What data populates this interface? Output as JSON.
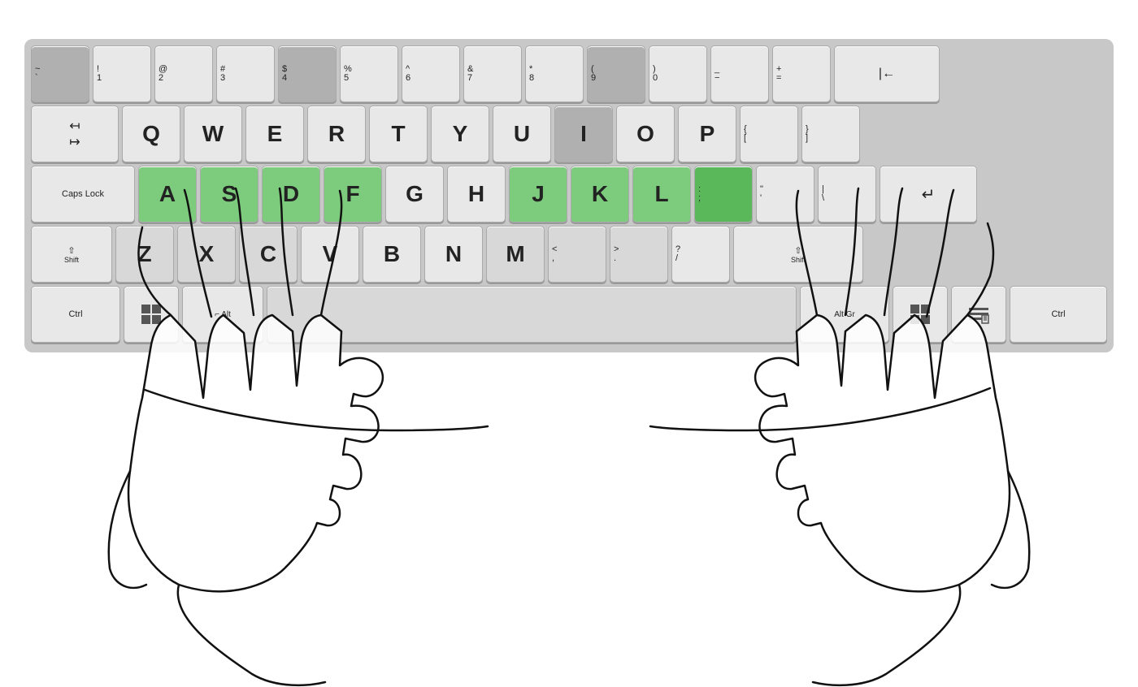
{
  "keyboard": {
    "rows": [
      {
        "id": "row-number",
        "keys": [
          {
            "id": "tilde",
            "top": "~",
            "bottom": "`",
            "label": "",
            "style": "dark",
            "w": "w1"
          },
          {
            "id": "1",
            "top": "!",
            "bottom": "1",
            "label": "",
            "style": "normal",
            "w": "w1"
          },
          {
            "id": "2",
            "top": "@",
            "bottom": "2",
            "label": "",
            "style": "normal",
            "w": "w1"
          },
          {
            "id": "3",
            "top": "#",
            "bottom": "3",
            "label": "",
            "style": "normal",
            "w": "w1"
          },
          {
            "id": "4",
            "top": "$",
            "bottom": "4",
            "label": "",
            "style": "dark",
            "w": "w1"
          },
          {
            "id": "5",
            "top": "%",
            "bottom": "5",
            "label": "",
            "style": "normal",
            "w": "w1"
          },
          {
            "id": "6",
            "top": "^",
            "bottom": "6",
            "label": "",
            "style": "normal",
            "w": "w1"
          },
          {
            "id": "7",
            "top": "&",
            "bottom": "7",
            "label": "",
            "style": "normal",
            "w": "w1"
          },
          {
            "id": "8",
            "top": "*",
            "bottom": "8",
            "label": "",
            "style": "normal",
            "w": "w1"
          },
          {
            "id": "9",
            "top": "(",
            "bottom": "9",
            "label": "",
            "style": "dark",
            "w": "w1"
          },
          {
            "id": "0",
            "top": ")",
            "bottom": "0",
            "label": "",
            "style": "normal",
            "w": "w1"
          },
          {
            "id": "minus",
            "top": "_",
            "bottom": "-",
            "label": "",
            "style": "normal",
            "w": "w1"
          },
          {
            "id": "equal",
            "top": "+",
            "bottom": "=",
            "label": "",
            "style": "normal",
            "w": "w1"
          },
          {
            "id": "backspace",
            "top": "",
            "bottom": "",
            "label": "←—",
            "style": "normal",
            "w": "w-backspace"
          }
        ]
      },
      {
        "id": "row-qwerty",
        "keys": [
          {
            "id": "tab",
            "top": "",
            "bottom": "",
            "label": "↤\n↦",
            "style": "normal",
            "w": "w-tab"
          },
          {
            "id": "q",
            "top": "",
            "bottom": "",
            "main": "Q",
            "style": "normal",
            "w": "w1"
          },
          {
            "id": "w",
            "top": "",
            "bottom": "",
            "main": "W",
            "style": "normal",
            "w": "w1"
          },
          {
            "id": "e",
            "top": "",
            "bottom": "",
            "main": "E",
            "style": "normal",
            "w": "w1"
          },
          {
            "id": "r",
            "top": "",
            "bottom": "",
            "main": "R",
            "style": "normal",
            "w": "w1"
          },
          {
            "id": "t",
            "top": "",
            "bottom": "",
            "main": "T",
            "style": "normal",
            "w": "w1"
          },
          {
            "id": "y",
            "top": "",
            "bottom": "",
            "main": "Y",
            "style": "normal",
            "w": "w1"
          },
          {
            "id": "u",
            "top": "",
            "bottom": "",
            "main": "U",
            "style": "normal",
            "w": "w1"
          },
          {
            "id": "i",
            "top": "",
            "bottom": "",
            "main": "I",
            "style": "dark",
            "w": "w1"
          },
          {
            "id": "o",
            "top": "",
            "bottom": "",
            "main": "O",
            "style": "normal",
            "w": "w1"
          },
          {
            "id": "p",
            "top": "",
            "bottom": "",
            "main": "P",
            "style": "normal",
            "w": "w1"
          },
          {
            "id": "lbracket",
            "top": "{",
            "bottom": "[",
            "label": "",
            "style": "normal",
            "w": "w1"
          },
          {
            "id": "rbracket",
            "top": "}",
            "bottom": "]",
            "label": "",
            "style": "normal",
            "w": "w1"
          }
        ]
      },
      {
        "id": "row-asdf",
        "keys": [
          {
            "id": "capslock",
            "top": "",
            "bottom": "",
            "label": "Caps Lock",
            "style": "normal",
            "w": "w-caps"
          },
          {
            "id": "a",
            "top": "",
            "bottom": "",
            "main": "A",
            "style": "green",
            "w": "w1"
          },
          {
            "id": "s",
            "top": "",
            "bottom": "",
            "main": "S",
            "style": "green",
            "w": "w1"
          },
          {
            "id": "d",
            "top": "",
            "bottom": "",
            "main": "D",
            "style": "green",
            "w": "w1"
          },
          {
            "id": "f",
            "top": "",
            "bottom": "",
            "main": "F",
            "style": "green",
            "w": "w1"
          },
          {
            "id": "g",
            "top": "",
            "bottom": "",
            "main": "G",
            "style": "normal",
            "w": "w1"
          },
          {
            "id": "h",
            "top": "",
            "bottom": "",
            "main": "H",
            "style": "normal",
            "w": "w1"
          },
          {
            "id": "j",
            "top": "",
            "bottom": "",
            "main": "J",
            "style": "green",
            "w": "w1"
          },
          {
            "id": "k",
            "top": "",
            "bottom": "",
            "main": "K",
            "style": "green",
            "w": "w1"
          },
          {
            "id": "l",
            "top": "",
            "bottom": "",
            "main": "L",
            "style": "green",
            "w": "w1"
          },
          {
            "id": "semicolon",
            "top": ":",
            "bottom": ";",
            "label": "",
            "style": "green-dark",
            "w": "w1"
          },
          {
            "id": "quote",
            "top": "\"",
            "bottom": "'",
            "label": "",
            "style": "normal",
            "w": "w1"
          },
          {
            "id": "backslash",
            "top": "|",
            "bottom": "\\",
            "label": "",
            "style": "normal",
            "w": "w1"
          },
          {
            "id": "enter",
            "top": "",
            "bottom": "",
            "label": "↵",
            "style": "normal",
            "w": "w-enter"
          }
        ]
      },
      {
        "id": "row-zxcv",
        "keys": [
          {
            "id": "shift-left",
            "top": "",
            "bottom": "",
            "label": "⇧ Shift",
            "style": "normal",
            "w": "w-shift-left"
          },
          {
            "id": "z",
            "top": "",
            "bottom": "",
            "main": "Z",
            "style": "lightgray",
            "w": "w1"
          },
          {
            "id": "x",
            "top": "",
            "bottom": "",
            "main": "X",
            "style": "lightgray",
            "w": "w1"
          },
          {
            "id": "c",
            "top": "",
            "bottom": "",
            "main": "C",
            "style": "lightgray",
            "w": "w1"
          },
          {
            "id": "v",
            "top": "",
            "bottom": "",
            "main": "V",
            "style": "normal",
            "w": "w1"
          },
          {
            "id": "b",
            "top": "",
            "bottom": "",
            "main": "B",
            "style": "normal",
            "w": "w1"
          },
          {
            "id": "n",
            "top": "",
            "bottom": "",
            "main": "N",
            "style": "normal",
            "w": "w1"
          },
          {
            "id": "m",
            "top": "",
            "bottom": "",
            "main": "M",
            "style": "lightgray",
            "w": "w1"
          },
          {
            "id": "comma",
            "top": "<",
            "bottom": ",",
            "label": "",
            "style": "lightgray",
            "w": "w1"
          },
          {
            "id": "period",
            "top": ">",
            "bottom": ".",
            "label": "",
            "style": "lightgray",
            "w": "w1"
          },
          {
            "id": "slash",
            "top": "?",
            "bottom": "/",
            "label": "",
            "style": "normal",
            "w": "w1"
          },
          {
            "id": "shift-right",
            "top": "",
            "bottom": "",
            "label": "⇧ Shift",
            "style": "normal",
            "w": "w-shift-right"
          }
        ]
      },
      {
        "id": "row-ctrl",
        "keys": [
          {
            "id": "ctrl-left",
            "top": "",
            "bottom": "",
            "label": "Ctrl",
            "style": "normal",
            "w": "w-ctrl"
          },
          {
            "id": "win-left",
            "top": "",
            "bottom": "",
            "label": "⊞",
            "style": "normal",
            "w": "w-winkey"
          },
          {
            "id": "alt",
            "top": "",
            "bottom": "",
            "label": "⌐ Alt",
            "style": "normal",
            "w": "w-alt"
          },
          {
            "id": "space",
            "top": "",
            "bottom": "",
            "label": "",
            "style": "lightgray",
            "w": "w-space"
          },
          {
            "id": "altgr",
            "top": "",
            "bottom": "",
            "label": "Alt Gr",
            "style": "normal",
            "w": "w-altgr"
          },
          {
            "id": "win-right",
            "top": "",
            "bottom": "",
            "label": "⊞",
            "style": "normal",
            "w": "w-winkey"
          },
          {
            "id": "menu",
            "top": "",
            "bottom": "",
            "label": "☰",
            "style": "normal",
            "w": "w-menu"
          },
          {
            "id": "ctrl-right",
            "top": "",
            "bottom": "",
            "label": "Ctrl",
            "style": "normal",
            "w": "w-ctrl-right"
          }
        ]
      }
    ]
  }
}
